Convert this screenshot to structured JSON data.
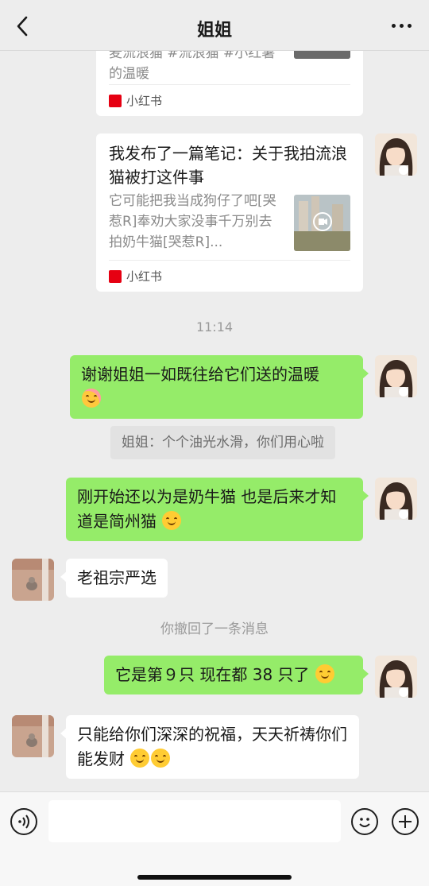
{
  "header": {
    "title": "姐姐"
  },
  "cards": [
    {
      "title_partial": "",
      "desc": "麦流浪猫 #流浪猫 #小红薯的温暖",
      "source": "小红书"
    },
    {
      "title": "我发布了一篇笔记：关于我拍流浪猫被打这件事",
      "desc": "它可能把我当成狗仔了吧[哭惹R]奉劝大家没事千万别去拍奶牛猫[哭惹R]...",
      "source": "小红书"
    }
  ],
  "xhs_logo_text": "小红书",
  "time_1": "11:14",
  "messages": {
    "m1": "谢谢姐姐一如既往给它们送的温暖",
    "quote1": "姐姐：个个油光水滑，你们用心啦",
    "m2": "刚开始还以为是奶牛猫 也是后来才知道是简州猫",
    "m3": "老祖宗严选",
    "sys1": "你撤回了一条消息",
    "m4": "它是第９只  现在都 38 只了",
    "m5": "只能给你们深深的祝福，天天祈祷你们能发财"
  },
  "icons": {
    "back": "chevron-left-icon",
    "more": "more-dots-icon",
    "voice": "voice-icon",
    "emoji": "emoji-icon",
    "plus": "plus-icon"
  },
  "colors": {
    "me_bubble": "#95ec69",
    "other_bubble": "#ffffff",
    "background": "#ededed",
    "xhs_red": "#e60012"
  }
}
